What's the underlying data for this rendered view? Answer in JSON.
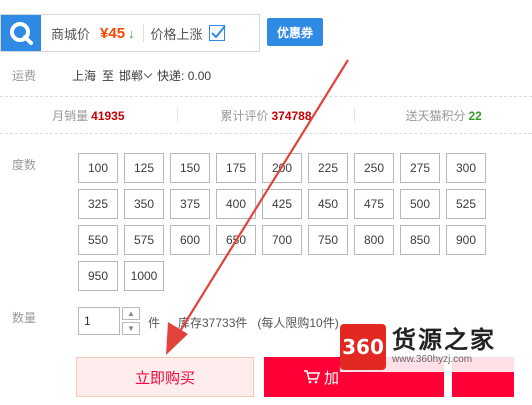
{
  "price_bar": {
    "logo_icon": "q-magnifier-icon",
    "mall_label": "商城价",
    "price": "¥45",
    "price_arrow": "↓",
    "price_up_label": "价格上涨",
    "coupon_label": "优惠券"
  },
  "shipping": {
    "label": "运费",
    "origin": "上海",
    "to": "至",
    "destination": "邯郸",
    "express": "快递: 0.00"
  },
  "stats": {
    "monthly_sales_label": "月销量",
    "monthly_sales": "41935",
    "total_reviews_label": "累计评价",
    "total_reviews": "374788",
    "tmall_points_label": "送天猫积分",
    "tmall_points": "22"
  },
  "degree": {
    "label": "度数",
    "options": [
      "100",
      "125",
      "150",
      "175",
      "200",
      "225",
      "250",
      "275",
      "300",
      "325",
      "350",
      "375",
      "400",
      "425",
      "450",
      "475",
      "500",
      "525",
      "550",
      "575",
      "600",
      "650",
      "700",
      "750",
      "800",
      "850",
      "900",
      "950",
      "1000"
    ]
  },
  "quantity": {
    "label": "数量",
    "value": "1",
    "unit": "件",
    "stock": "库存37733件",
    "limit": "(每人限购10件)"
  },
  "actions": {
    "buy_now": "立即购买",
    "add_to_cart": "加"
  },
  "watermark": {
    "badge": "360",
    "title": "货源之家",
    "url": "www.360hyzj.com"
  },
  "colors": {
    "accent_blue": "#2f8ae6",
    "price_orange": "#ff4400",
    "tmall_red": "#ff0036",
    "stat_red": "#c40000",
    "stat_green": "#3a9a2e",
    "annotation_red": "#e2433a"
  }
}
